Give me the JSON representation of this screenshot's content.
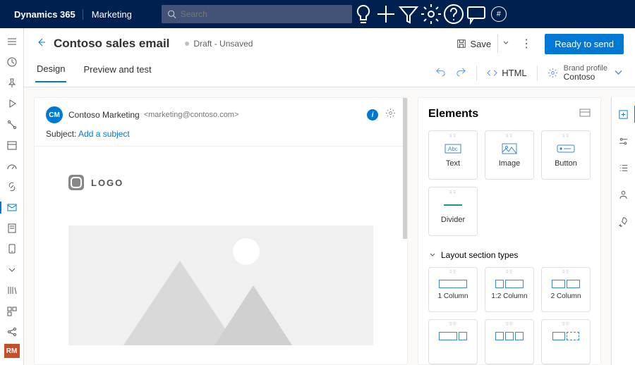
{
  "topnav": {
    "brand": "Dynamics 365",
    "module": "Marketing",
    "search_placeholder": "Search"
  },
  "cmdbar": {
    "title": "Contoso sales email",
    "status": "Draft - Unsaved",
    "save_label": "Save",
    "primary_label": "Ready to send"
  },
  "tabs": {
    "design": "Design",
    "preview": "Preview and test",
    "html_label": "HTML",
    "brand_label": "Brand profile",
    "brand_value": "Contoso"
  },
  "canvas": {
    "avatar_initials": "CM",
    "from_name": "Contoso Marketing",
    "from_email": "<marketing@contoso.com>",
    "subject_label": "Subject:",
    "subject_add": "Add a subject",
    "logo_text": "LOGO"
  },
  "panel": {
    "title": "Elements",
    "el_text": "Text",
    "el_image": "Image",
    "el_button": "Button",
    "el_divider": "Divider",
    "section_label": "Layout section types",
    "lay_1col": "1 Column",
    "lay_12col": "1:2 Column",
    "lay_2col": "2 Column"
  },
  "left_avatar": "RM"
}
